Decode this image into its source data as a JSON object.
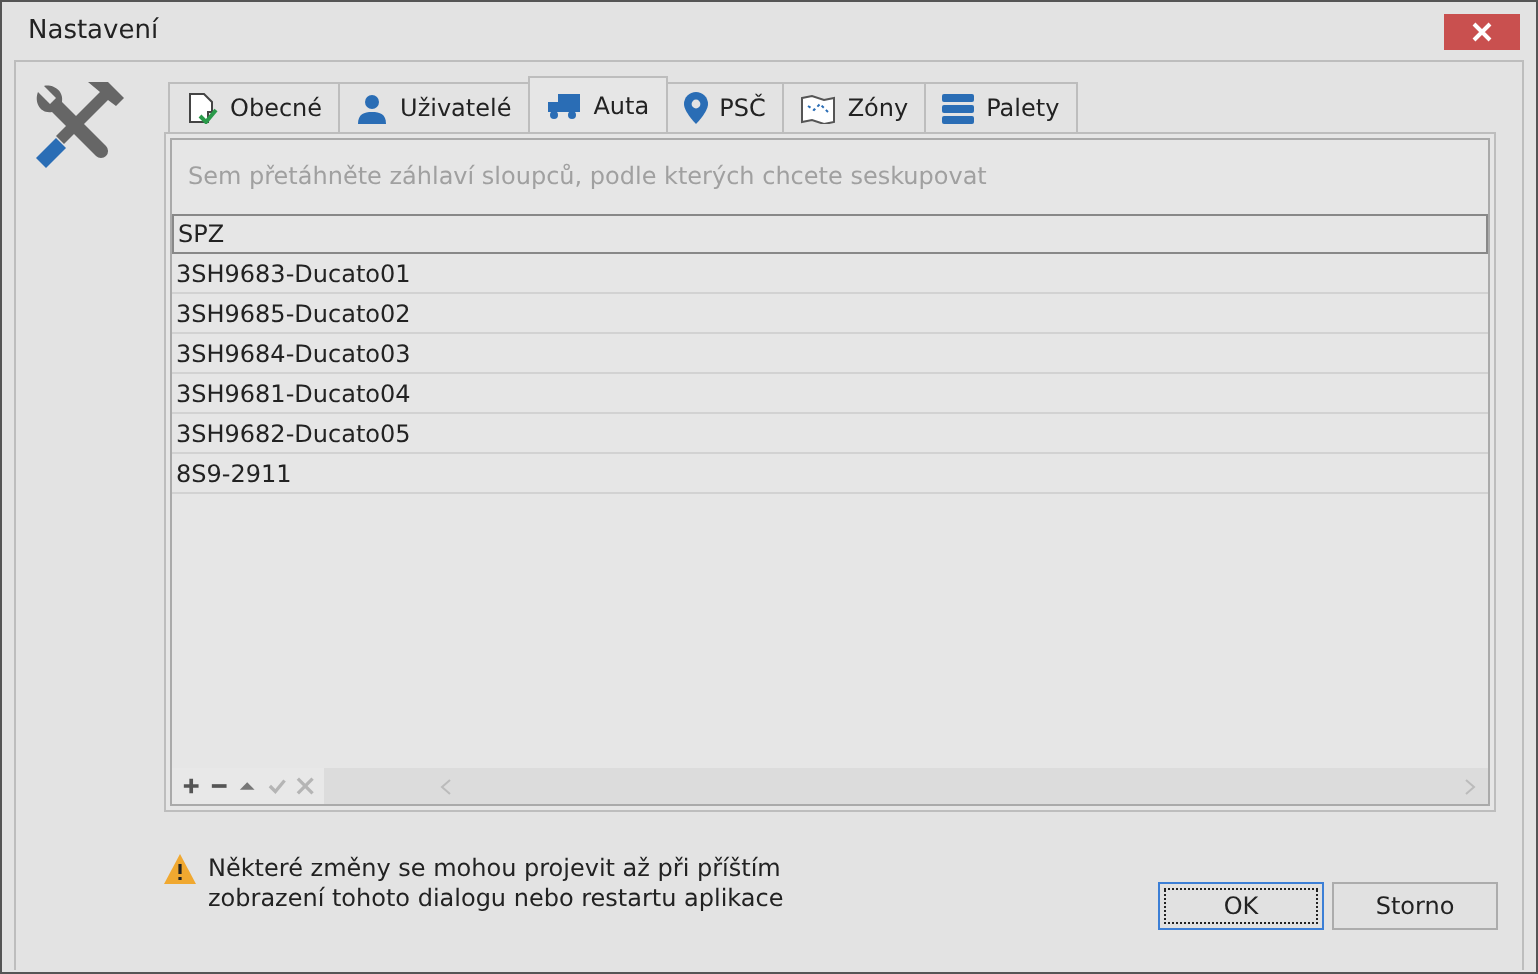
{
  "window": {
    "title": "Nastavení"
  },
  "tabs": [
    {
      "label": "Obecné",
      "selected": false
    },
    {
      "label": "Uživatelé",
      "selected": false
    },
    {
      "label": "Auta",
      "selected": true
    },
    {
      "label": "PSČ",
      "selected": false
    },
    {
      "label": "Zóny",
      "selected": false
    },
    {
      "label": "Palety",
      "selected": false
    }
  ],
  "grid": {
    "group_panel_hint": "Sem přetáhněte záhlaví sloupců, podle kterých chcete seskupovat",
    "columns": [
      "SPZ"
    ],
    "rows": [
      [
        "3SH9683-Ducato01"
      ],
      [
        "3SH9685-Ducato02"
      ],
      [
        "3SH9684-Ducato03"
      ],
      [
        "3SH9681-Ducato04"
      ],
      [
        "3SH9682-Ducato05"
      ],
      [
        "8S9-2911"
      ]
    ],
    "navigator": [
      {
        "disabled": false
      },
      {
        "disabled": false
      },
      {
        "disabled": false
      },
      {
        "disabled": true
      },
      {
        "disabled": true
      }
    ]
  },
  "warning": "Některé změny se mohou projevit až při příštím zobrazení tohoto dialogu nebo restartu aplikace",
  "buttons": [
    {
      "label": "OK",
      "default": true
    },
    {
      "label": "Storno",
      "default": false
    }
  ]
}
